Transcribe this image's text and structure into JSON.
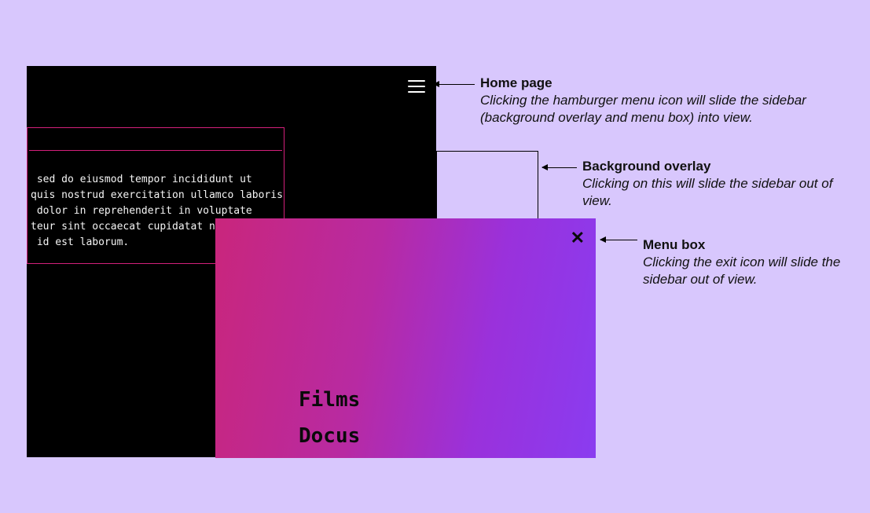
{
  "homepage": {
    "lorem_lines": " sed do eiusmod tempor incididunt ut\nquis nostrud exercitation ullamco laboris\n dolor in reprehenderit in voluptate\nteur sint occaecat cupidatat non\n id est laborum."
  },
  "menu": {
    "items": [
      "Films",
      "Docus"
    ],
    "close_glyph": "✕"
  },
  "annotations": {
    "home": {
      "title": "Home page",
      "desc": "Clicking the hamburger menu icon will slide the sidebar (background overlay and menu box) into view."
    },
    "overlay": {
      "title": "Background overlay",
      "desc": "Clicking on this will slide the sidebar out of view."
    },
    "menu": {
      "title": "Menu box",
      "desc": "Clicking the exit icon will slide the sidebar out of view."
    }
  }
}
